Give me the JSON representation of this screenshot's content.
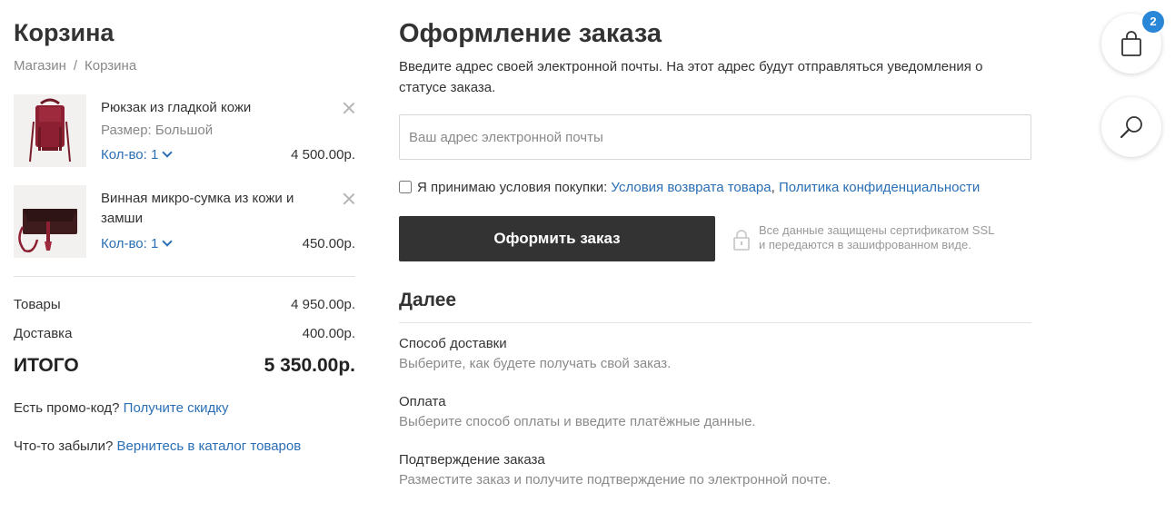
{
  "cart": {
    "title": "Корзина",
    "breadcrumb": {
      "shop": "Магазин",
      "separator": "/",
      "current": "Корзина"
    },
    "items": [
      {
        "name": "Рюкзак из гладкой кожи",
        "size": "Размер: Большой",
        "qty": "Кол-во: 1",
        "price": "4 500.00р."
      },
      {
        "name": "Винная микро-сумка из кожи и замши",
        "qty": "Кол-во: 1",
        "price": "450.00р."
      }
    ],
    "summary": {
      "goods_label": "Товары",
      "goods_value": "4 950.00р.",
      "delivery_label": "Доставка",
      "delivery_value": "400.00р.",
      "total_label": "ИТОГО",
      "total_value": "5 350.00р."
    },
    "promo": {
      "text": "Есть промо-код?",
      "link": "Получите скидку"
    },
    "forgot": {
      "text": "Что-то забыли?",
      "link": "Вернитесь в каталог товаров"
    }
  },
  "checkout": {
    "title": "Оформление заказа",
    "description": "Введите адрес своей электронной почты. На этот адрес будут отправляться уведомления о статусе заказа.",
    "email_placeholder": "Ваш адрес электронной почты",
    "terms": {
      "text": "Я принимаю условия покупки:",
      "link1": "Условия возврата товара",
      "comma": ",",
      "link2": "Политика конфиденциальности"
    },
    "order_button": "Оформить заказ",
    "ssl_line1": "Все данные защищены сертификатом SSL",
    "ssl_line2": "и передаются в зашифрованном виде.",
    "next_title": "Далее",
    "steps": [
      {
        "title": "Способ доставки",
        "desc": "Выберите, как будете получать свой заказ."
      },
      {
        "title": "Оплата",
        "desc": "Выберите способ оплаты и введите платёжные данные."
      },
      {
        "title": "Подтверждение заказа",
        "desc": "Разместите заказ и получите подтверждение по электронной почте."
      }
    ]
  },
  "floating": {
    "cart_count": "2"
  },
  "colors": {
    "link": "#2a6fb5",
    "button": "#333333",
    "badge": "#2a86d6"
  },
  "icons": [
    "close-icon",
    "chevron-down-icon",
    "lock-icon",
    "shopping-bag-icon",
    "search-icon"
  ]
}
